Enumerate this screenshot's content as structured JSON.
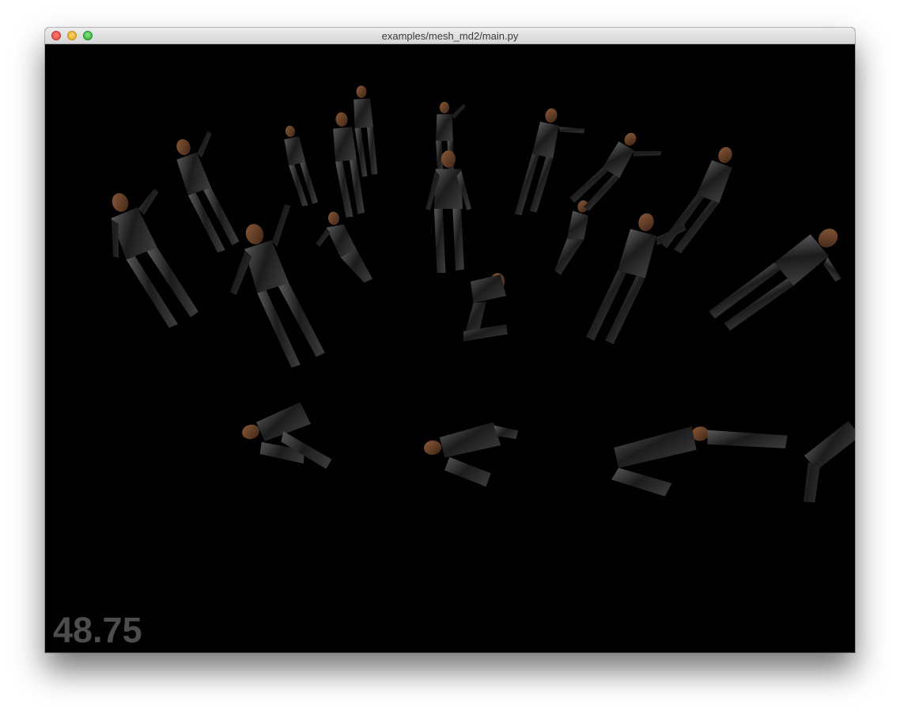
{
  "window": {
    "title": "examples/mesh_md2/main.py"
  },
  "viewport": {
    "background_color": "#000000",
    "fps_readout": "48.75",
    "fps_color": "#4d4d4d",
    "models": [
      {
        "pose": "standing-waving"
      },
      {
        "pose": "standing-arm-raised"
      },
      {
        "pose": "standing-reaching"
      },
      {
        "pose": "standing"
      },
      {
        "pose": "standing"
      },
      {
        "pose": "standing"
      },
      {
        "pose": "standing-arms-out"
      },
      {
        "pose": "crouching"
      },
      {
        "pose": "crouching"
      },
      {
        "pose": "falling-back"
      },
      {
        "pose": "running"
      },
      {
        "pose": "leaping"
      },
      {
        "pose": "leaping"
      },
      {
        "pose": "crouched-forward"
      },
      {
        "pose": "lying-down"
      },
      {
        "pose": "lying-down"
      },
      {
        "pose": "lying-down"
      },
      {
        "pose": "lying-down"
      }
    ]
  }
}
